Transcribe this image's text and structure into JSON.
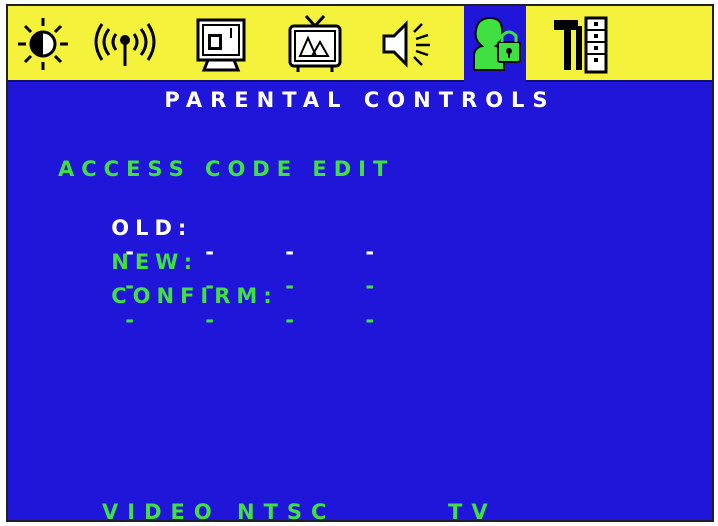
{
  "colors": {
    "menu_bar_bg": "#f4f23a",
    "screen_bg": "#1f16d9",
    "active_text": "#ffffff",
    "inactive_text": "#3fe03f"
  },
  "menu_tabs": [
    {
      "icon": "brightness-icon",
      "active": false
    },
    {
      "icon": "antenna-icon",
      "active": false
    },
    {
      "icon": "monitor-icon",
      "active": false
    },
    {
      "icon": "tv-icon",
      "active": false
    },
    {
      "icon": "speaker-icon",
      "active": false
    },
    {
      "icon": "parental-lock-icon",
      "active": true
    },
    {
      "icon": "tools-icon",
      "active": false
    }
  ],
  "screen_title": "PARENTAL CONTROLS",
  "access_code": {
    "heading": "ACCESS CODE EDIT",
    "rows": [
      {
        "label": "OLD:",
        "placeholder": "- - - -",
        "selected": true
      },
      {
        "label": "NEW:",
        "placeholder": "- - - -",
        "selected": false
      },
      {
        "label": "CONFIRM:",
        "placeholder": "- - - -",
        "selected": false
      }
    ]
  },
  "footer": {
    "video_mode": "VIDEO NTSC",
    "source": "TV"
  }
}
